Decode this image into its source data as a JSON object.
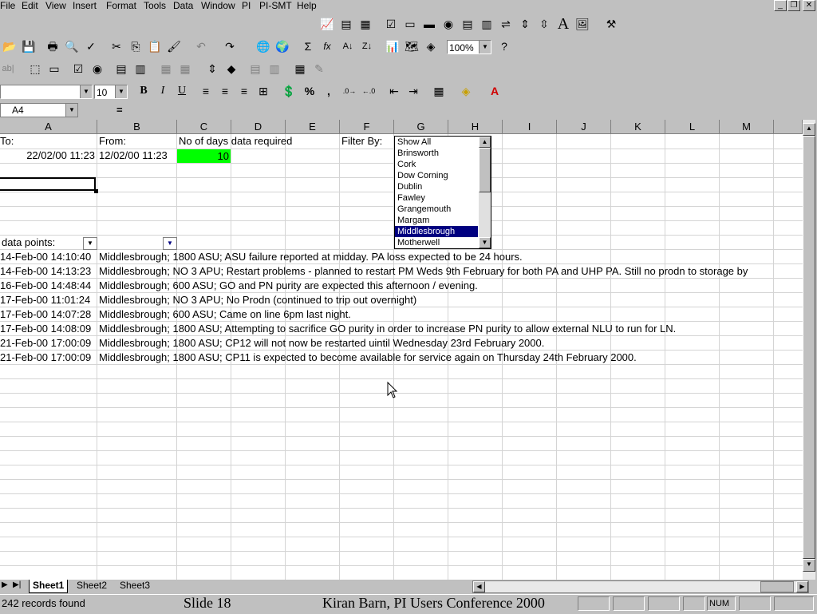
{
  "menu": [
    "File",
    "Edit",
    "View",
    "Insert",
    "Format",
    "Tools",
    "Data",
    "Window",
    "PI",
    "PI-SMT",
    "Help"
  ],
  "toolbar": {
    "zoom": "100%",
    "font_size": "10",
    "bold": "B",
    "italic": "I",
    "underline": "U",
    "percent": "%",
    "comma": ",",
    "sum": "Σ",
    "fx": "fx",
    "large_a": "A"
  },
  "formula_bar": {
    "name_box": "A4",
    "equals": "="
  },
  "columns": [
    "A",
    "B",
    "C",
    "D",
    "E",
    "F",
    "G",
    "H",
    "I",
    "J",
    "K",
    "L",
    "M"
  ],
  "labels": {
    "to": "To:",
    "from": "From:",
    "days": "No of days data required",
    "filter": "Filter By:",
    "data_points": "data points:"
  },
  "values": {
    "to_date": "22/02/00 11:23",
    "from_date": "12/02/00 11:23",
    "days": "10"
  },
  "filter_list": [
    "Show All",
    "Brinsworth",
    "Cork",
    "Dow Corning",
    "Dublin",
    "Fawley",
    "Grangemouth",
    "Margam",
    "Middlesbrough",
    "Motherwell"
  ],
  "filter_selected": "Middlesbrough",
  "records": [
    {
      "time": "14-Feb-00 14:10:40",
      "text": "Middlesbrough; 1800 ASU; ASU failure reported at midday. PA loss expected to be 24 hours."
    },
    {
      "time": "14-Feb-00 14:13:23",
      "text": "Middlesbrough; NO 3 APU; Restart problems - planned to restart PM Weds 9th February for both PA and UHP PA. Still no prodn to storage by"
    },
    {
      "time": "16-Feb-00 14:48:44",
      "text": "Middlesbrough; 600 ASU; GO and PN purity are expected this afternoon / evening."
    },
    {
      "time": "17-Feb-00 11:01:24",
      "text": "Middlesbrough; NO 3 APU; No Prodn (continued to trip out overnight)"
    },
    {
      "time": "17-Feb-00 14:07:28",
      "text": "Middlesbrough; 600 ASU; Came on line 6pm last night."
    },
    {
      "time": "17-Feb-00 14:08:09",
      "text": "Middlesbrough; 1800 ASU; Attempting to sacrifice GO purity in order to increase PN purity to allow external NLU to run for LN."
    },
    {
      "time": "21-Feb-00 17:00:09",
      "text": "Middlesbrough; 1800 ASU; CP12 will not now be restarted uintil Wednesday 23rd February 2000."
    },
    {
      "time": "21-Feb-00 17:00:09",
      "text": "Middlesbrough; 1800 ASU; CP11 is expected to become available for service again on Thursday 24th February 2000."
    }
  ],
  "sheets": [
    "Sheet1",
    "Sheet2",
    "Sheet3"
  ],
  "status": {
    "records": "242 records found",
    "slide": "Slide 18",
    "caption": "Kiran Barn, PI Users Conference 2000",
    "num": "NUM"
  },
  "colors": {
    "highlight_cell": "#00ff00",
    "selected_item": "#000080"
  }
}
